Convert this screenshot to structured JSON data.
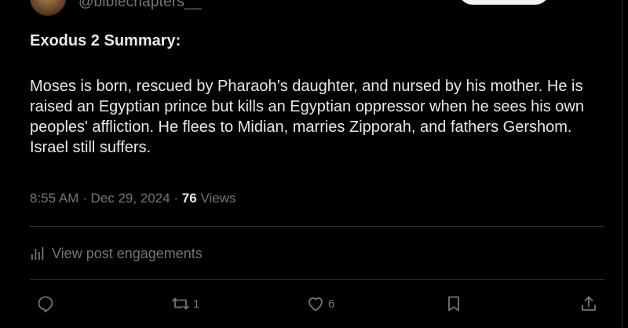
{
  "author": {
    "handle": "@biblechapters__"
  },
  "post": {
    "title": "Exodus 2 Summary:",
    "body": "Moses is born, rescued by Pharaoh’s daughter, and nursed by his mother. He is raised an Egyptian prince but kills an Egyptian oppressor when he sees his own peoples' affliction. He flees to Midian, marries Zipporah, and fathers Gershom. Israel still suffers.",
    "time": "8:55 AM",
    "separator": "·",
    "date": "Dec 29, 2024",
    "views_count": "76",
    "views_label": "Views"
  },
  "engagements": {
    "label": "View post engagements",
    "icon": "bar-chart-icon"
  },
  "actions": {
    "reply": {
      "icon": "reply-icon",
      "count": ""
    },
    "repost": {
      "icon": "repost-icon",
      "count": "1"
    },
    "like": {
      "icon": "heart-icon",
      "count": "6"
    },
    "bookmark": {
      "icon": "bookmark-icon",
      "count": ""
    },
    "share": {
      "icon": "share-icon",
      "count": ""
    }
  },
  "colors": {
    "background": "#000000",
    "text": "#e7e9ea",
    "muted": "#71767b",
    "divider": "#2f3336"
  }
}
